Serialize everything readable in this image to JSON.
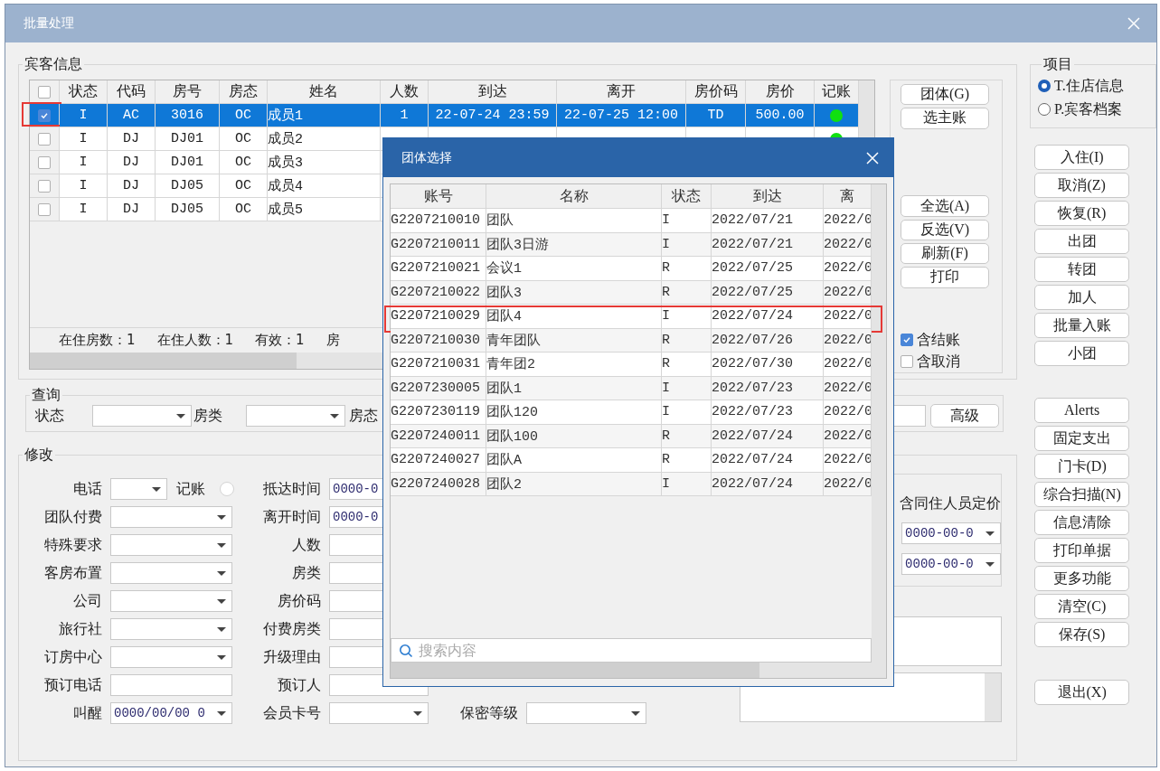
{
  "window": {
    "title": "批量处理"
  },
  "guest_info": {
    "legend": "宾客信息",
    "header_checked": false,
    "columns": [
      "状态",
      "代码",
      "房号",
      "房态",
      "姓名",
      "人数",
      "到达",
      "离开",
      "房价码",
      "房价",
      "记账"
    ],
    "rows": [
      {
        "checked": true,
        "selected": true,
        "highlighted": true,
        "posted": true,
        "cells": [
          "I",
          "AC",
          "3016",
          "OC",
          "成员1",
          "1",
          "22-07-24 23:59",
          "22-07-25 12:00",
          "TD",
          "500.00"
        ]
      },
      {
        "checked": false,
        "selected": false,
        "highlighted": false,
        "posted": true,
        "cells": [
          "I",
          "DJ",
          "DJ01",
          "OC",
          "成员2"
        ]
      },
      {
        "checked": false,
        "selected": false,
        "highlighted": false,
        "posted": false,
        "cells": [
          "I",
          "DJ",
          "DJ01",
          "OC",
          "成员3"
        ]
      },
      {
        "checked": false,
        "selected": false,
        "highlighted": false,
        "posted": false,
        "cells": [
          "I",
          "DJ",
          "DJ05",
          "OC",
          "成员4"
        ]
      },
      {
        "checked": false,
        "selected": false,
        "highlighted": false,
        "posted": false,
        "cells": [
          "I",
          "DJ",
          "DJ05",
          "OC",
          "成员5"
        ]
      }
    ],
    "summary": [
      "在住房数：1",
      "在住人数：1",
      "有效：1",
      "房"
    ],
    "top_buttons": [
      "团体(G)",
      "选主账"
    ],
    "select_buttons": [
      "全选(A)",
      "反选(V)",
      "刷新(F)",
      "打印"
    ],
    "filters": [
      {
        "label": "含结账",
        "checked": true
      },
      {
        "label": "含取消",
        "checked": false
      }
    ]
  },
  "query": {
    "legend": "查询",
    "labels": [
      "状态",
      "房类",
      "房态"
    ],
    "advanced_button": "高级"
  },
  "modify": {
    "legend": "修改",
    "posting": {
      "label": "记账",
      "on": false
    },
    "column_1": [
      {
        "label": "电话",
        "kind": "short"
      },
      {
        "label": "团队付费",
        "kind": "dropdown"
      },
      {
        "label": "特殊要求",
        "kind": "dropdown"
      },
      {
        "label": "客房布置",
        "kind": "dropdown"
      },
      {
        "label": "公司",
        "kind": "dropdown"
      },
      {
        "label": "旅行社",
        "kind": "dropdown"
      },
      {
        "label": "订房中心",
        "kind": "dropdown"
      },
      {
        "label": "预订电话",
        "kind": "text"
      },
      {
        "label": "叫醒",
        "kind": "dropdown",
        "value": "0000/00/00 0"
      }
    ],
    "column_2": [
      {
        "label": "抵达时间",
        "kind": "text",
        "value": "0000-0"
      },
      {
        "label": "离开时间",
        "kind": "text",
        "value": "0000-0"
      },
      {
        "label": "人数",
        "kind": "text"
      },
      {
        "label": "房类",
        "kind": "text"
      },
      {
        "label": "房价码",
        "kind": "text"
      },
      {
        "label": "付费房类",
        "kind": "text"
      },
      {
        "label": "升级理由",
        "kind": "text"
      },
      {
        "label": "预订人",
        "kind": "text"
      },
      {
        "label": "会员卡号",
        "kind": "dropdown"
      }
    ],
    "secrecy": {
      "label": "保密等级"
    },
    "pricing": {
      "label": "含同住人员定价",
      "dates": [
        "0000-00-0",
        "0000-00-0"
      ]
    }
  },
  "project": {
    "legend": "项目",
    "options": [
      {
        "label": "T.住店信息",
        "selected": true
      },
      {
        "label": "P.宾客档案",
        "selected": false
      }
    ]
  },
  "actions": [
    "入住(I)",
    "取消(Z)",
    "恢复(R)",
    "出团",
    "转团",
    "加人",
    "批量入账",
    "小团"
  ],
  "more_actions": [
    "Alerts",
    "固定支出",
    "门卡(D)",
    "综合扫描(N)",
    "信息清除",
    "打印单据",
    "更多功能",
    "清空(C)",
    "保存(S)"
  ],
  "exit_button": "退出(X)",
  "group_dialog": {
    "title": "团体选择",
    "columns": [
      "账号",
      "名称",
      "状态",
      "到达",
      "离"
    ],
    "rows": [
      {
        "highlighted": false,
        "cells": [
          "G2207210010",
          "团队",
          "I",
          "2022/07/21",
          "2022/0"
        ]
      },
      {
        "highlighted": false,
        "cells": [
          "G2207210011",
          "团队3日游",
          "I",
          "2022/07/21",
          "2022/0"
        ]
      },
      {
        "highlighted": false,
        "cells": [
          "G2207210021",
          "会议1",
          "R",
          "2022/07/25",
          "2022/0"
        ]
      },
      {
        "highlighted": false,
        "cells": [
          "G2207210022",
          "团队3",
          "R",
          "2022/07/25",
          "2022/0"
        ]
      },
      {
        "highlighted": true,
        "cells": [
          "G2207210029",
          "团队4",
          "I",
          "2022/07/24",
          "2022/0"
        ]
      },
      {
        "highlighted": false,
        "cells": [
          "G2207210030",
          "青年团队",
          "R",
          "2022/07/26",
          "2022/0"
        ]
      },
      {
        "highlighted": false,
        "cells": [
          "G2207210031",
          "青年团2",
          "R",
          "2022/07/30",
          "2022/0"
        ]
      },
      {
        "highlighted": false,
        "cells": [
          "G2207230005",
          "团队1",
          "I",
          "2022/07/23",
          "2022/0"
        ]
      },
      {
        "highlighted": false,
        "cells": [
          "G2207230119",
          "团队120",
          "I",
          "2022/07/23",
          "2022/0"
        ]
      },
      {
        "highlighted": false,
        "cells": [
          "G2207240011",
          "团队100",
          "R",
          "2022/07/24",
          "2022/0"
        ]
      },
      {
        "highlighted": false,
        "cells": [
          "G2207240027",
          "团队A",
          "R",
          "2022/07/24",
          "2022/0"
        ]
      },
      {
        "highlighted": false,
        "cells": [
          "G2207240028",
          "团队2",
          "I",
          "2022/07/24",
          "2022/0"
        ]
      }
    ],
    "search": {
      "placeholder": "搜索内容"
    }
  }
}
